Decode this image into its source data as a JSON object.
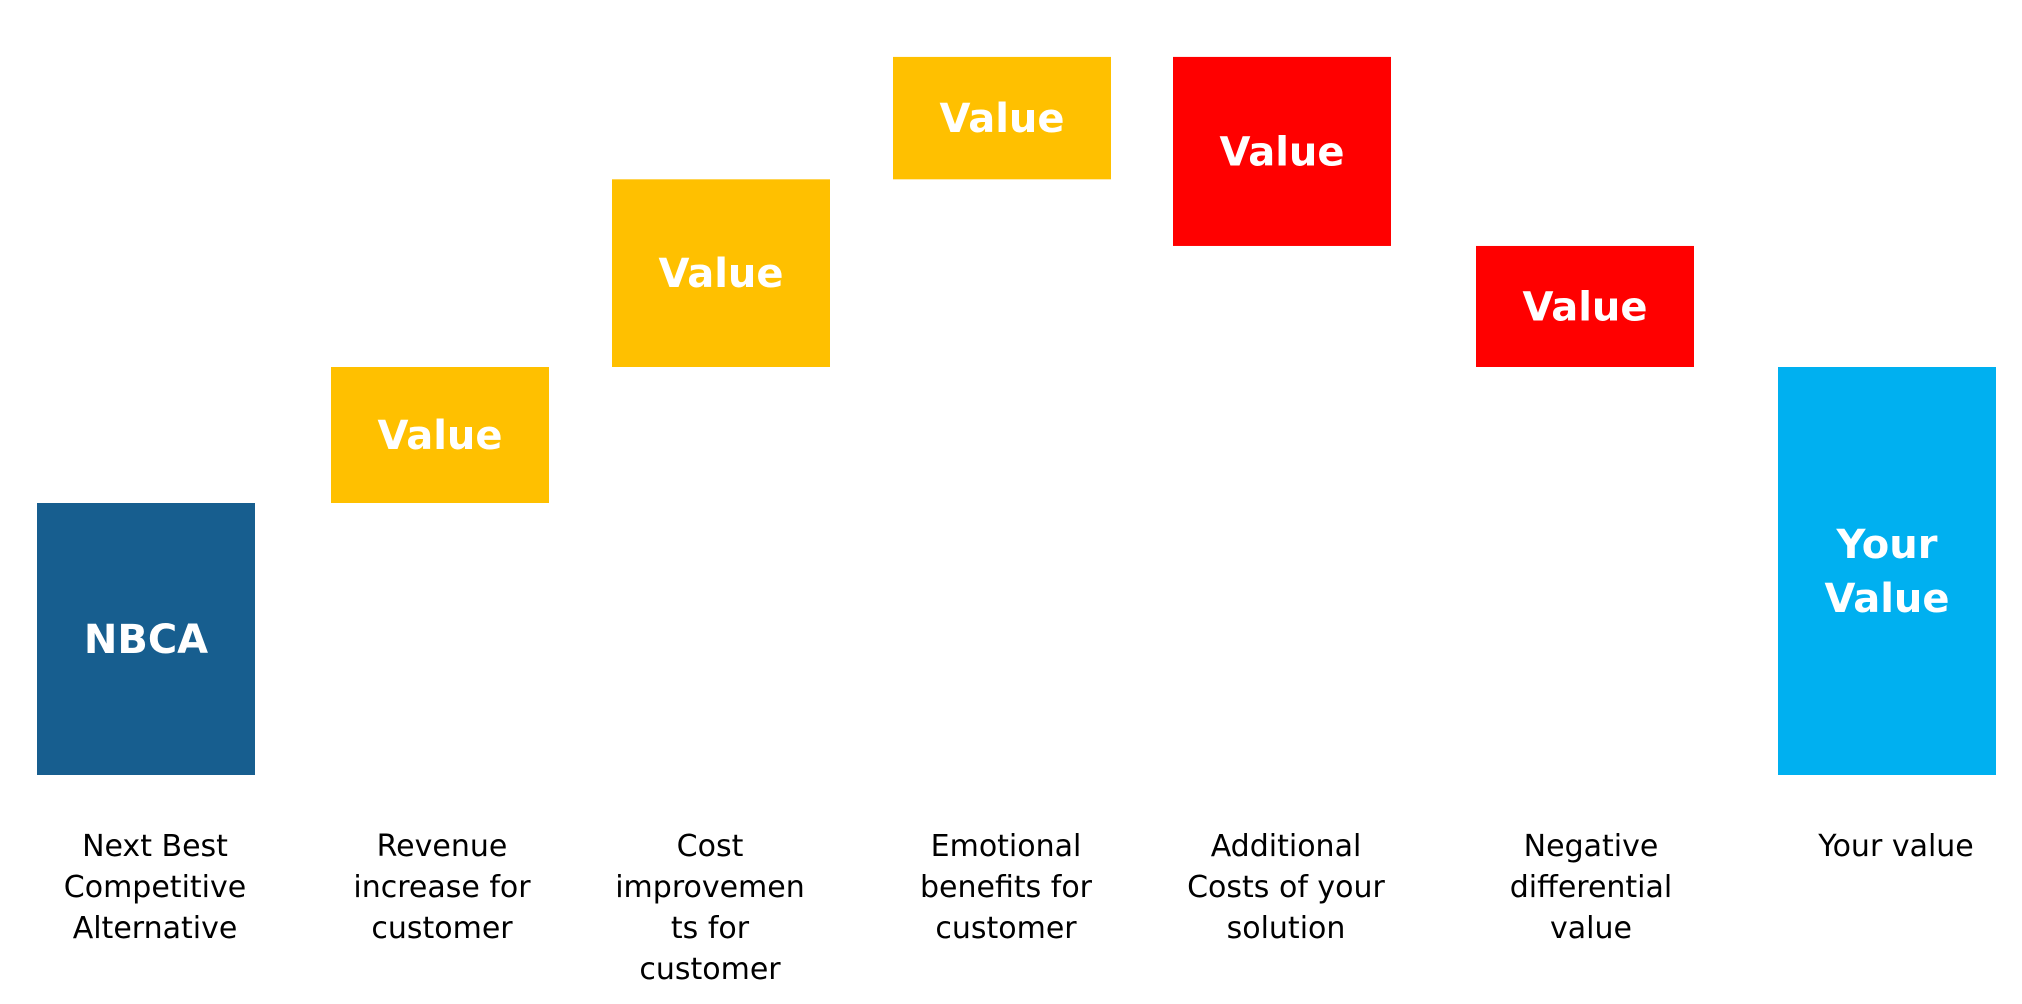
{
  "chart_data": {
    "type": "bar",
    "subtype": "waterfall",
    "title": "",
    "xlabel": "",
    "ylabel": "",
    "grid": false,
    "legend": "none",
    "axes_visible": false,
    "ylim": [
      0,
      5.3
    ],
    "categories": [
      [
        "Next Best",
        "Competitive",
        "Alternative"
      ],
      [
        "Revenue",
        "increase for",
        "customer"
      ],
      [
        "Cost",
        "improvemen",
        "ts for",
        "customer"
      ],
      [
        "Emotional",
        "benefits for",
        "customer"
      ],
      [
        "Additional",
        "Costs of your",
        "solution"
      ],
      [
        "Negative",
        "differential",
        "value"
      ],
      [
        "Your value"
      ]
    ],
    "bars": [
      {
        "name": "NBCA",
        "kind": "total",
        "start": 0,
        "end": 2.0,
        "label": [
          "NBCA"
        ],
        "color": "#175E8F"
      },
      {
        "name": "Revenue increase",
        "kind": "increase",
        "start": 2.0,
        "end": 3.0,
        "label": [
          "Value"
        ],
        "color": "#FFC000"
      },
      {
        "name": "Cost improvements",
        "kind": "increase",
        "start": 3.0,
        "end": 4.38,
        "label": [
          "Value"
        ],
        "color": "#FFC000"
      },
      {
        "name": "Emotional benefits",
        "kind": "increase",
        "start": 4.38,
        "end": 5.28,
        "label": [
          "Value"
        ],
        "color": "#FFC000"
      },
      {
        "name": "Additional costs",
        "kind": "decrease",
        "start": 5.28,
        "end": 3.89,
        "label": [
          "Value"
        ],
        "color": "#FF0000"
      },
      {
        "name": "Negative differential value",
        "kind": "decrease",
        "start": 3.89,
        "end": 3.0,
        "label": [
          "Value"
        ],
        "color": "#FF0000"
      },
      {
        "name": "Your Value",
        "kind": "total",
        "start": 0,
        "end": 3.0,
        "label": [
          "Your",
          "Value"
        ],
        "color": "#00B0F0"
      }
    ]
  }
}
